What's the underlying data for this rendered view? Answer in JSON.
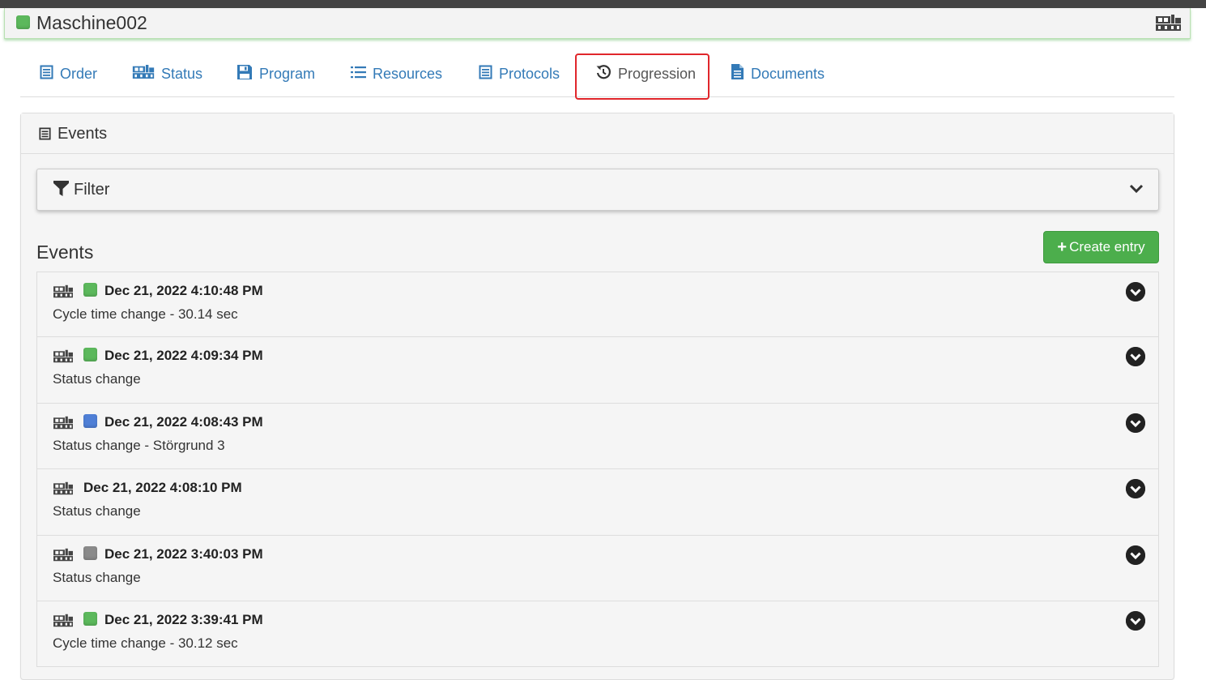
{
  "header": {
    "machine_name": "Maschine002",
    "status_color": "#5cb85c"
  },
  "tabs": [
    {
      "label": "Order",
      "icon": "list-alt-icon"
    },
    {
      "label": "Status",
      "icon": "machine-icon"
    },
    {
      "label": "Program",
      "icon": "floppy-disk-icon"
    },
    {
      "label": "Resources",
      "icon": "list-icon"
    },
    {
      "label": "Protocols",
      "icon": "list-alt-icon"
    },
    {
      "label": "Progression",
      "icon": "history-icon",
      "active": true
    },
    {
      "label": "Documents",
      "icon": "file-icon"
    }
  ],
  "panel": {
    "title": "Events"
  },
  "filter": {
    "label": "Filter"
  },
  "events": {
    "title": "Events",
    "create_label": "Create entry",
    "items": [
      {
        "date": "Dec 21, 2022 4:10:48 PM",
        "description": "Cycle time change - 30.14 sec",
        "status_color": "#5cb85c"
      },
      {
        "date": "Dec 21, 2022 4:09:34 PM",
        "description": "Status change",
        "status_color": "#5cb85c"
      },
      {
        "date": "Dec 21, 2022 4:08:43 PM",
        "description": "Status change - Störgrund 3",
        "status_color": "#4f7fd6"
      },
      {
        "date": "Dec 21, 2022 4:08:10 PM",
        "description": "Status change",
        "status_color": null
      },
      {
        "date": "Dec 21, 2022 3:40:03 PM",
        "description": "Status change",
        "status_color": "#8a8a8a"
      },
      {
        "date": "Dec 21, 2022 3:39:41 PM",
        "description": "Cycle time change - 30.12 sec",
        "status_color": "#5cb85c"
      }
    ]
  }
}
